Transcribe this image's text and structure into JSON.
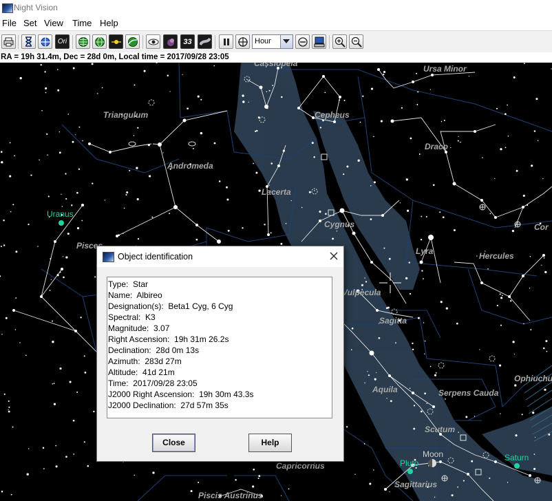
{
  "window": {
    "title": "Night Vision"
  },
  "menu": [
    "File",
    "Set",
    "View",
    "Time",
    "Help"
  ],
  "toolbar": {
    "buttons": [
      "print-icon",
      "hourglass-icon",
      "compass-icon",
      "ori-icon",
      "globe-grid-icon",
      "globe-lines-icon",
      "ecliptic-icon",
      "galaxy-globe-icon",
      "eye-icon",
      "nebula-icon",
      "messier-33-icon",
      "milky-way-icon",
      "pause-icon",
      "target-icon",
      "zoom-minus-circle-icon",
      "computer-icon",
      "zoom-in-icon",
      "zoom-out-icon"
    ],
    "ori_label": "Ori",
    "m33_label": "33",
    "step_unit": "Hour"
  },
  "status": "RA = 19h 31.4m, Dec = 28d 0m, Local time = 2017/09/28 23:05",
  "sky": {
    "constellations": [
      "Cassiopeia",
      "Ursa Minor",
      "Triangulum",
      "Cepheus",
      "Draco",
      "Andromeda",
      "Lacerta",
      "Cygnus",
      "Pisces",
      "Lyra",
      "Hercules",
      "Cor",
      "Vulpecula",
      "Sagitta",
      "Aquila",
      "Serpens Cauda",
      "Ophiuchu",
      "Scutum",
      "Capricornus",
      "Sagittarius",
      "Piscis Austrinus"
    ],
    "planets": [
      {
        "name": "Uranus",
        "color": "#1fd4a0"
      },
      {
        "name": "Pluto",
        "color": "#1fd4a0"
      },
      {
        "name": "Saturn",
        "color": "#1fd4a0"
      },
      {
        "name": "Moon",
        "color": "#cfcfcf"
      }
    ],
    "colors": {
      "background": "#000000",
      "milky_way": "#2c3f52",
      "constellation_lines": "#e6e6e6",
      "boundaries": "#1d4275",
      "labels": "#a8a8a8",
      "planets": "#1fd4a0"
    }
  },
  "dialog": {
    "title": "Object identification",
    "lines": [
      "Type:  Star",
      "Name:  Albireo",
      "Designation(s):  Beta1 Cyg, 6 Cyg",
      "Spectral:  K3",
      "Magnitude:  3.07",
      "Right Ascension:  19h 31m 26.2s",
      "Declination:  28d 0m 13s",
      "Azimuth:  283d 27m",
      "Altitude:  41d 21m",
      "Time:  2017/09/28 23:05",
      "J2000 Right Ascension:  19h 30m 43.3s",
      "J2000 Declination:  27d 57m 35s"
    ],
    "close_label": "Close",
    "help_label": "Help"
  }
}
